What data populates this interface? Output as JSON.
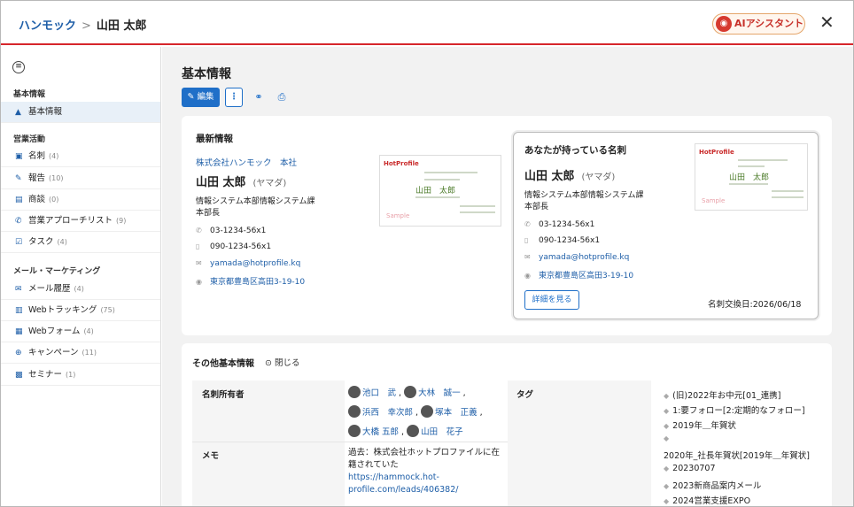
{
  "header": {
    "breadcrumb_root": "ハンモック",
    "breadcrumb_sep": ">",
    "breadcrumb_current": "山田 太郎",
    "ai_button": "AIアシスタント",
    "close": "✕"
  },
  "sidebar": {
    "menu_icon": "≡",
    "section_basic": "基本情報",
    "item_basic": "基本情報",
    "section_sales": "営業活動",
    "sales_items": [
      {
        "label": "名刺",
        "count": "(4)",
        "icon": "id-card-icon"
      },
      {
        "label": "報告",
        "count": "(10)",
        "icon": "pencil-icon"
      },
      {
        "label": "商談",
        "count": "(0)",
        "icon": "cash-icon"
      },
      {
        "label": "営業アプローチリスト",
        "count": "(9)",
        "icon": "phone-icon"
      },
      {
        "label": "タスク",
        "count": "(4)",
        "icon": "check-icon"
      }
    ],
    "section_mail": "メール・マーケティング",
    "mail_items": [
      {
        "label": "メール履歴",
        "count": "(4)",
        "icon": "mail-icon"
      },
      {
        "label": "Webトラッキング",
        "count": "(75)",
        "icon": "bar-chart-icon"
      },
      {
        "label": "Webフォーム",
        "count": "(4)",
        "icon": "form-icon"
      },
      {
        "label": "キャンペーン",
        "count": "(11)",
        "icon": "target-icon"
      },
      {
        "label": "セミナー",
        "count": "(1)",
        "icon": "monitor-icon"
      }
    ]
  },
  "main": {
    "title": "基本情報",
    "toolbar": {
      "edit": "編集",
      "more": "⋮"
    },
    "latest": {
      "heading": "最新情報",
      "company": "株式会社ハンモック　本社",
      "name": "山田 太郎",
      "kana": "(ヤマダ)",
      "dept": "情報システム本部情報システム課",
      "title": "本部長",
      "phone": "03-1234-56x1",
      "mobile": "090-1234-56x1",
      "email": "yamada@hotprofile.kq",
      "address": "東京都豊島区高田3-19-10"
    },
    "card_image": {
      "logo": "HotProfile",
      "name": "山田　太郎",
      "sample": "Sample"
    },
    "own_card": {
      "heading": "あなたが持っている名刺",
      "name": "山田 太郎",
      "kana": "(ヤマダ)",
      "dept": "情報システム本部情報システム課",
      "title": "本部長",
      "phone": "03-1234-56x1",
      "mobile": "090-1234-56x1",
      "email": "yamada@hotprofile.kq",
      "address": "東京都豊島区高田3-19-10",
      "detail_button": "詳細を見る",
      "exchange_date": "名刺交換日:2026/06/18"
    },
    "other": {
      "heading": "その他基本情報",
      "close": "閉じる",
      "owner_label": "名刺所有者",
      "owners": [
        "池口　武",
        "大林　誠一",
        "浜西　幸次郎",
        "塚本　正義",
        "大橋 五郎",
        "山田　花子"
      ],
      "memo_label": "メモ",
      "memo_text": "過去：株式会社ホットプロファイルに在籍されていた",
      "memo_link": "https://hammock.hot-profile.com/leads/406382/",
      "tag_label": "タグ",
      "tags": [
        "(旧)2022年お中元[01_連携]",
        "1:要フォロー[2:定期的なフォロー]",
        "2019年＿年賀状",
        "",
        "2020年_社長年賀状[2019年＿年賀状]",
        "20230707",
        "2023新商品案内メール",
        "2024営業支援EXPO"
      ]
    }
  }
}
